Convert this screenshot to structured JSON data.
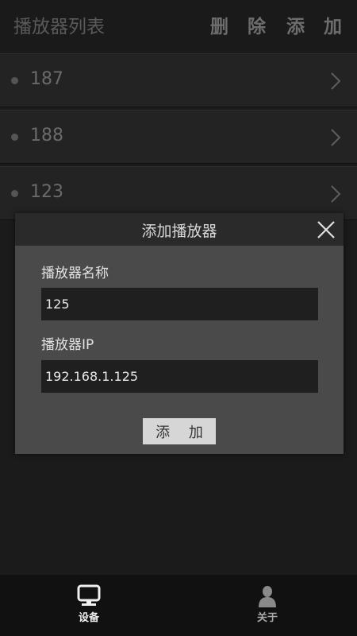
{
  "header": {
    "title": "播放器列表",
    "delete_label": "删 除",
    "add_label": "添 加"
  },
  "players": [
    {
      "label": "187"
    },
    {
      "label": "188"
    },
    {
      "label": "123"
    }
  ],
  "dialog": {
    "title": "添加播放器",
    "name_label": "播放器名称",
    "name_value": "125",
    "ip_label": "播放器IP",
    "ip_value": "192.168.1.125",
    "submit_label": "添 加"
  },
  "bottom_nav": {
    "devices_label": "设备",
    "about_label": "关于",
    "active": "devices"
  },
  "icons": {
    "list_chevron": "chevron-right-icon",
    "dialog_close": "close-icon",
    "devices": "monitor-icon",
    "about": "person-icon"
  }
}
